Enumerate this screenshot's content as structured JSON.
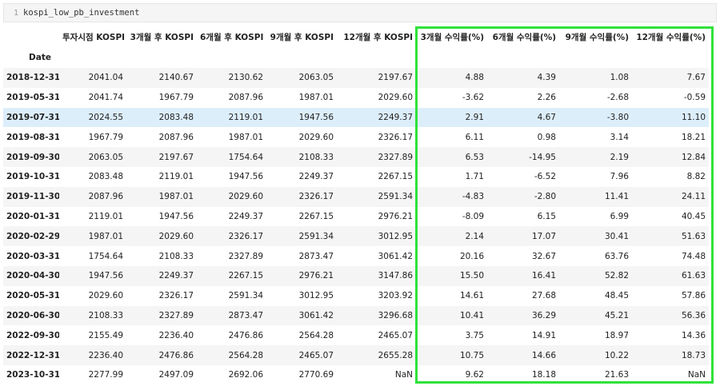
{
  "cell": {
    "line_number": "1",
    "code": "kospi_low_pb_investment"
  },
  "table": {
    "index_name": "Date",
    "columns": [
      "투자시점 KOSPI",
      "3개월 후 KOSPI",
      "6개월 후 KOSPI",
      "9개월 후 KOSPI",
      "12개월 후 KOSPI",
      "3개월 수익률(%)",
      "6개월 수익률(%)",
      "9개월 수익률(%)",
      "12개월 수익률(%)"
    ],
    "rows": [
      {
        "date": "2018-12-31",
        "values": [
          "2041.04",
          "2140.67",
          "2130.62",
          "2063.05",
          "2197.67",
          "4.88",
          "4.39",
          "1.08",
          "7.67"
        ]
      },
      {
        "date": "2019-05-31",
        "values": [
          "2041.74",
          "1967.79",
          "2087.96",
          "1987.01",
          "2029.60",
          "-3.62",
          "2.26",
          "-2.68",
          "-0.59"
        ]
      },
      {
        "date": "2019-07-31",
        "values": [
          "2024.55",
          "2083.48",
          "2119.01",
          "1947.56",
          "2249.37",
          "2.91",
          "4.67",
          "-3.80",
          "11.10"
        ]
      },
      {
        "date": "2019-08-31",
        "values": [
          "1967.79",
          "2087.96",
          "1987.01",
          "2029.60",
          "2326.17",
          "6.11",
          "0.98",
          "3.14",
          "18.21"
        ]
      },
      {
        "date": "2019-09-30",
        "values": [
          "2063.05",
          "2197.67",
          "1754.64",
          "2108.33",
          "2327.89",
          "6.53",
          "-14.95",
          "2.19",
          "12.84"
        ]
      },
      {
        "date": "2019-10-31",
        "values": [
          "2083.48",
          "2119.01",
          "1947.56",
          "2249.37",
          "2267.15",
          "1.71",
          "-6.52",
          "7.96",
          "8.82"
        ]
      },
      {
        "date": "2019-11-30",
        "values": [
          "2087.96",
          "1987.01",
          "2029.60",
          "2326.17",
          "2591.34",
          "-4.83",
          "-2.80",
          "11.41",
          "24.11"
        ]
      },
      {
        "date": "2020-01-31",
        "values": [
          "2119.01",
          "1947.56",
          "2249.37",
          "2267.15",
          "2976.21",
          "-8.09",
          "6.15",
          "6.99",
          "40.45"
        ]
      },
      {
        "date": "2020-02-29",
        "values": [
          "1987.01",
          "2029.60",
          "2326.17",
          "2591.34",
          "3012.95",
          "2.14",
          "17.07",
          "30.41",
          "51.63"
        ]
      },
      {
        "date": "2020-03-31",
        "values": [
          "1754.64",
          "2108.33",
          "2327.89",
          "2873.47",
          "3061.42",
          "20.16",
          "32.67",
          "63.76",
          "74.48"
        ]
      },
      {
        "date": "2020-04-30",
        "values": [
          "1947.56",
          "2249.37",
          "2267.15",
          "2976.21",
          "3147.86",
          "15.50",
          "16.41",
          "52.82",
          "61.63"
        ]
      },
      {
        "date": "2020-05-31",
        "values": [
          "2029.60",
          "2326.17",
          "2591.34",
          "3012.95",
          "3203.92",
          "14.61",
          "27.68",
          "48.45",
          "57.86"
        ]
      },
      {
        "date": "2020-06-30",
        "values": [
          "2108.33",
          "2327.89",
          "2873.47",
          "3061.42",
          "3296.68",
          "10.41",
          "36.29",
          "45.21",
          "56.36"
        ]
      },
      {
        "date": "2022-09-30",
        "values": [
          "2155.49",
          "2236.40",
          "2476.86",
          "2564.28",
          "2465.07",
          "3.75",
          "14.91",
          "18.97",
          "14.36"
        ]
      },
      {
        "date": "2022-12-31",
        "values": [
          "2236.40",
          "2476.86",
          "2564.28",
          "2465.07",
          "2655.28",
          "10.75",
          "14.66",
          "10.22",
          "18.73"
        ]
      },
      {
        "date": "2023-10-31",
        "values": [
          "2277.99",
          "2497.09",
          "2692.06",
          "2770.69",
          "NaN",
          "9.62",
          "18.18",
          "21.63",
          "NaN"
        ]
      }
    ],
    "highlighted_row": "2019-07-31"
  },
  "colors": {
    "highlight_box": "#2fe23a",
    "row_hover": "#ddeefb",
    "row_stripe": "#f5f5f5"
  }
}
